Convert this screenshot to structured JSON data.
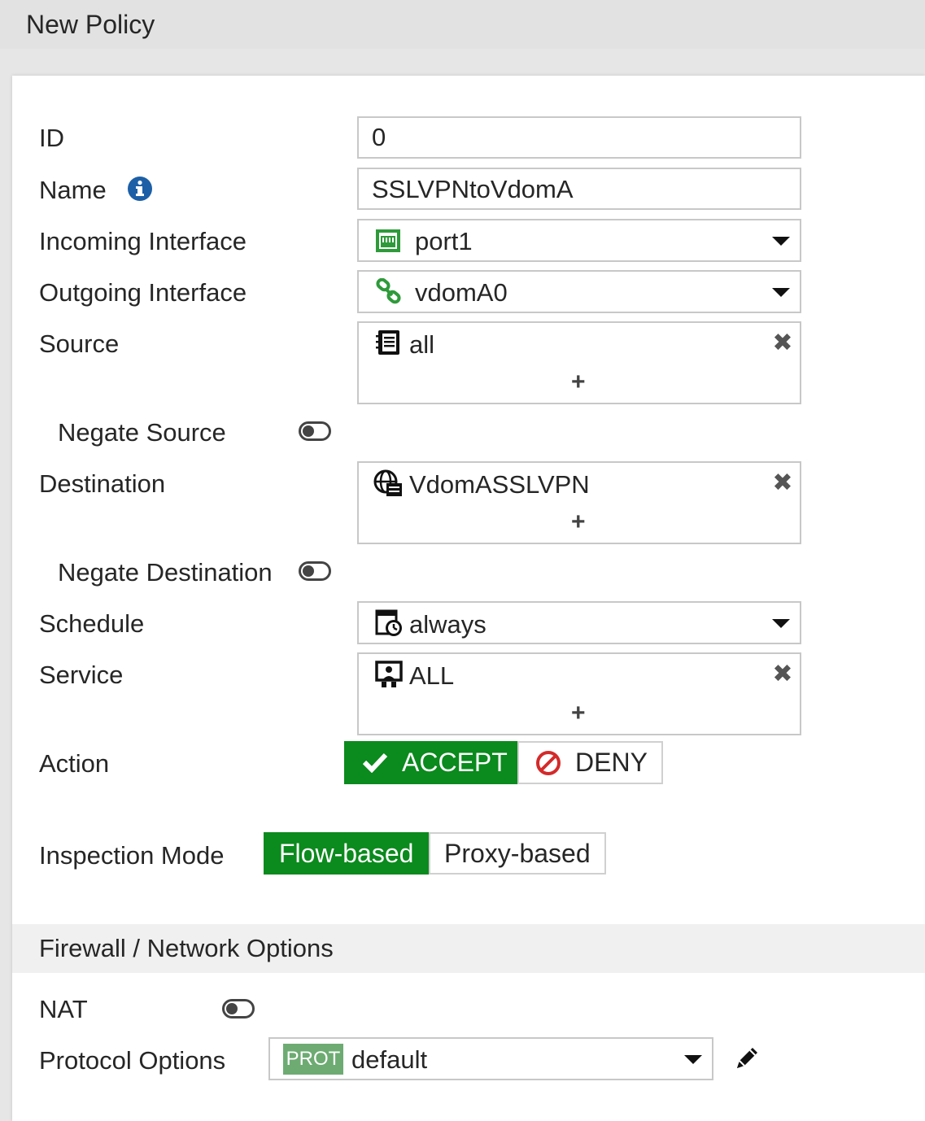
{
  "title": "New Policy",
  "form": {
    "id": {
      "label": "ID",
      "value": "0"
    },
    "name": {
      "label": "Name",
      "value": "SSLVPNtoVdomA",
      "info_icon": "info-icon"
    },
    "incoming_interface": {
      "label": "Incoming Interface",
      "value": "port1",
      "icon": "port-icon"
    },
    "outgoing_interface": {
      "label": "Outgoing Interface",
      "value": "vdomA0",
      "icon": "link-icon"
    },
    "source": {
      "label": "Source",
      "value": "all",
      "icon": "address-book-icon",
      "add": "+"
    },
    "negate_source": {
      "label": "Negate Source",
      "enabled": false
    },
    "destination": {
      "label": "Destination",
      "value": "VdomASSLVPN",
      "icon": "globe-server-icon",
      "add": "+"
    },
    "negate_destination": {
      "label": "Negate Destination",
      "enabled": false
    },
    "schedule": {
      "label": "Schedule",
      "value": "always",
      "icon": "schedule-icon"
    },
    "service": {
      "label": "Service",
      "value": "ALL",
      "icon": "service-icon",
      "add": "+"
    },
    "action": {
      "label": "Action",
      "accept": "ACCEPT",
      "deny": "DENY",
      "selected": "ACCEPT"
    },
    "inspection_mode": {
      "label": "Inspection Mode",
      "flow": "Flow-based",
      "proxy": "Proxy-based",
      "selected": "Flow-based"
    }
  },
  "firewall_section": {
    "title": "Firewall / Network Options",
    "nat": {
      "label": "NAT",
      "enabled": false
    },
    "protocol_options": {
      "label": "Protocol Options",
      "badge": "PROT",
      "value": "default"
    }
  },
  "colors": {
    "accent_green": "#0b8a1d",
    "info_blue": "#1c5fa6",
    "deny_red": "#d42a2a",
    "badge_green": "#6dab73"
  }
}
